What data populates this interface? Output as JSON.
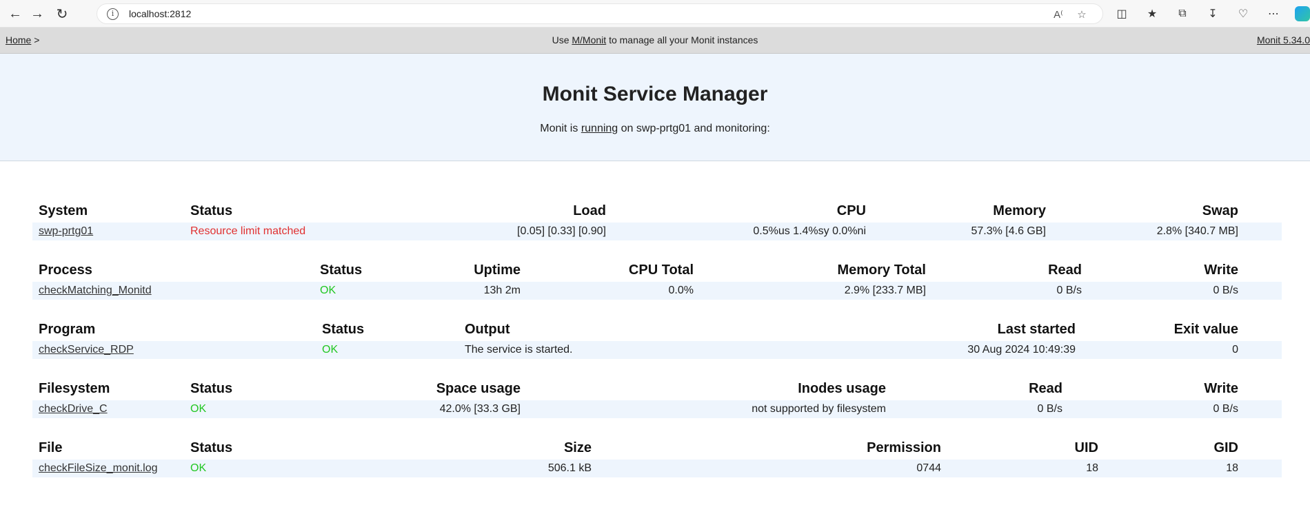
{
  "browser": {
    "url": "localhost:2812"
  },
  "topbar": {
    "home_link": "Home",
    "breadcrumb_sep": ">",
    "center_prefix": "Use",
    "mmonit_link": "M/Monit",
    "center_suffix": "to manage all your Monit instances",
    "version_link": "Monit 5.34.0"
  },
  "hero": {
    "title": "Monit Service Manager",
    "sub_prefix": "Monit is",
    "sub_link": "running",
    "sub_suffix": "on swp-prtg01 and monitoring:"
  },
  "system": {
    "headers": [
      "System",
      "Status",
      "Load",
      "CPU",
      "Memory",
      "Swap"
    ],
    "row": {
      "name": "swp-prtg01",
      "status": "Resource limit matched",
      "load": "[0.05] [0.33] [0.90]",
      "cpu": "0.5%us 1.4%sy 0.0%ni",
      "memory": "57.3% [4.6 GB]",
      "swap": "2.8% [340.7 MB]"
    }
  },
  "process": {
    "headers": [
      "Process",
      "Status",
      "Uptime",
      "CPU Total",
      "Memory Total",
      "Read",
      "Write"
    ],
    "row": {
      "name": "checkMatching_Monitd",
      "status": "OK",
      "uptime": "13h 2m",
      "cpu_total": "0.0%",
      "memory_total": "2.9% [233.7 MB]",
      "read": "0 B/s",
      "write": "0 B/s"
    }
  },
  "program": {
    "headers": [
      "Program",
      "Status",
      "Output",
      "Last started",
      "Exit value"
    ],
    "row": {
      "name": "checkService_RDP",
      "status": "OK",
      "output": "The service is started.",
      "last_started": "30 Aug 2024 10:49:39",
      "exit_value": "0"
    }
  },
  "filesystem": {
    "headers": [
      "Filesystem",
      "Status",
      "Space usage",
      "Inodes usage",
      "Read",
      "Write"
    ],
    "row": {
      "name": "checkDrive_C",
      "status": "OK",
      "space_usage": "42.0% [33.3 GB]",
      "inodes_usage": "not supported by filesystem",
      "read": "0 B/s",
      "write": "0 B/s"
    }
  },
  "file": {
    "headers": [
      "File",
      "Status",
      "Size",
      "Permission",
      "UID",
      "GID"
    ],
    "row": {
      "name": "checkFileSize_monit.log",
      "status": "OK",
      "size": "506.1 kB",
      "permission": "0744",
      "uid": "18",
      "gid": "18"
    }
  },
  "colors": {
    "ok": "#22c722",
    "error": "#e03030",
    "row_bg": "#eef5fd"
  }
}
